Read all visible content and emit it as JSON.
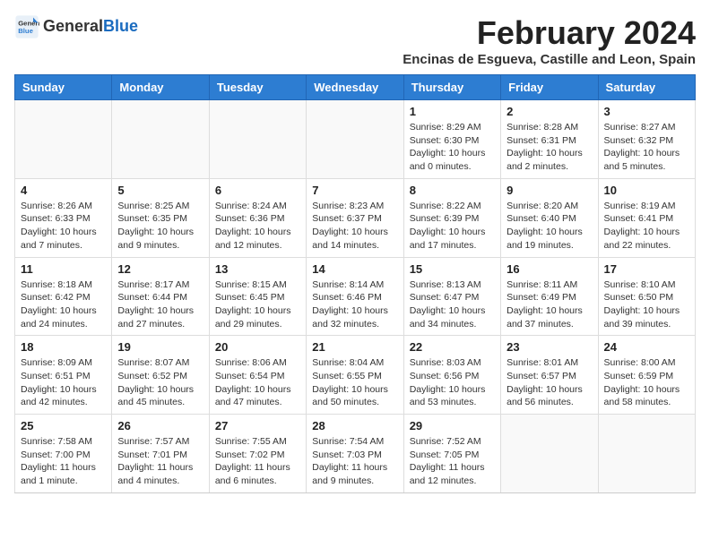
{
  "logo": {
    "line1": "General",
    "line2": "Blue"
  },
  "title": {
    "month_year": "February 2024",
    "location": "Encinas de Esgueva, Castille and Leon, Spain"
  },
  "weekdays": [
    "Sunday",
    "Monday",
    "Tuesday",
    "Wednesday",
    "Thursday",
    "Friday",
    "Saturday"
  ],
  "weeks": [
    [
      {
        "day": "",
        "info": ""
      },
      {
        "day": "",
        "info": ""
      },
      {
        "day": "",
        "info": ""
      },
      {
        "day": "",
        "info": ""
      },
      {
        "day": "1",
        "info": "Sunrise: 8:29 AM\nSunset: 6:30 PM\nDaylight: 10 hours\nand 0 minutes."
      },
      {
        "day": "2",
        "info": "Sunrise: 8:28 AM\nSunset: 6:31 PM\nDaylight: 10 hours\nand 2 minutes."
      },
      {
        "day": "3",
        "info": "Sunrise: 8:27 AM\nSunset: 6:32 PM\nDaylight: 10 hours\nand 5 minutes."
      }
    ],
    [
      {
        "day": "4",
        "info": "Sunrise: 8:26 AM\nSunset: 6:33 PM\nDaylight: 10 hours\nand 7 minutes."
      },
      {
        "day": "5",
        "info": "Sunrise: 8:25 AM\nSunset: 6:35 PM\nDaylight: 10 hours\nand 9 minutes."
      },
      {
        "day": "6",
        "info": "Sunrise: 8:24 AM\nSunset: 6:36 PM\nDaylight: 10 hours\nand 12 minutes."
      },
      {
        "day": "7",
        "info": "Sunrise: 8:23 AM\nSunset: 6:37 PM\nDaylight: 10 hours\nand 14 minutes."
      },
      {
        "day": "8",
        "info": "Sunrise: 8:22 AM\nSunset: 6:39 PM\nDaylight: 10 hours\nand 17 minutes."
      },
      {
        "day": "9",
        "info": "Sunrise: 8:20 AM\nSunset: 6:40 PM\nDaylight: 10 hours\nand 19 minutes."
      },
      {
        "day": "10",
        "info": "Sunrise: 8:19 AM\nSunset: 6:41 PM\nDaylight: 10 hours\nand 22 minutes."
      }
    ],
    [
      {
        "day": "11",
        "info": "Sunrise: 8:18 AM\nSunset: 6:42 PM\nDaylight: 10 hours\nand 24 minutes."
      },
      {
        "day": "12",
        "info": "Sunrise: 8:17 AM\nSunset: 6:44 PM\nDaylight: 10 hours\nand 27 minutes."
      },
      {
        "day": "13",
        "info": "Sunrise: 8:15 AM\nSunset: 6:45 PM\nDaylight: 10 hours\nand 29 minutes."
      },
      {
        "day": "14",
        "info": "Sunrise: 8:14 AM\nSunset: 6:46 PM\nDaylight: 10 hours\nand 32 minutes."
      },
      {
        "day": "15",
        "info": "Sunrise: 8:13 AM\nSunset: 6:47 PM\nDaylight: 10 hours\nand 34 minutes."
      },
      {
        "day": "16",
        "info": "Sunrise: 8:11 AM\nSunset: 6:49 PM\nDaylight: 10 hours\nand 37 minutes."
      },
      {
        "day": "17",
        "info": "Sunrise: 8:10 AM\nSunset: 6:50 PM\nDaylight: 10 hours\nand 39 minutes."
      }
    ],
    [
      {
        "day": "18",
        "info": "Sunrise: 8:09 AM\nSunset: 6:51 PM\nDaylight: 10 hours\nand 42 minutes."
      },
      {
        "day": "19",
        "info": "Sunrise: 8:07 AM\nSunset: 6:52 PM\nDaylight: 10 hours\nand 45 minutes."
      },
      {
        "day": "20",
        "info": "Sunrise: 8:06 AM\nSunset: 6:54 PM\nDaylight: 10 hours\nand 47 minutes."
      },
      {
        "day": "21",
        "info": "Sunrise: 8:04 AM\nSunset: 6:55 PM\nDaylight: 10 hours\nand 50 minutes."
      },
      {
        "day": "22",
        "info": "Sunrise: 8:03 AM\nSunset: 6:56 PM\nDaylight: 10 hours\nand 53 minutes."
      },
      {
        "day": "23",
        "info": "Sunrise: 8:01 AM\nSunset: 6:57 PM\nDaylight: 10 hours\nand 56 minutes."
      },
      {
        "day": "24",
        "info": "Sunrise: 8:00 AM\nSunset: 6:59 PM\nDaylight: 10 hours\nand 58 minutes."
      }
    ],
    [
      {
        "day": "25",
        "info": "Sunrise: 7:58 AM\nSunset: 7:00 PM\nDaylight: 11 hours\nand 1 minute."
      },
      {
        "day": "26",
        "info": "Sunrise: 7:57 AM\nSunset: 7:01 PM\nDaylight: 11 hours\nand 4 minutes."
      },
      {
        "day": "27",
        "info": "Sunrise: 7:55 AM\nSunset: 7:02 PM\nDaylight: 11 hours\nand 6 minutes."
      },
      {
        "day": "28",
        "info": "Sunrise: 7:54 AM\nSunset: 7:03 PM\nDaylight: 11 hours\nand 9 minutes."
      },
      {
        "day": "29",
        "info": "Sunrise: 7:52 AM\nSunset: 7:05 PM\nDaylight: 11 hours\nand 12 minutes."
      },
      {
        "day": "",
        "info": ""
      },
      {
        "day": "",
        "info": ""
      }
    ]
  ]
}
